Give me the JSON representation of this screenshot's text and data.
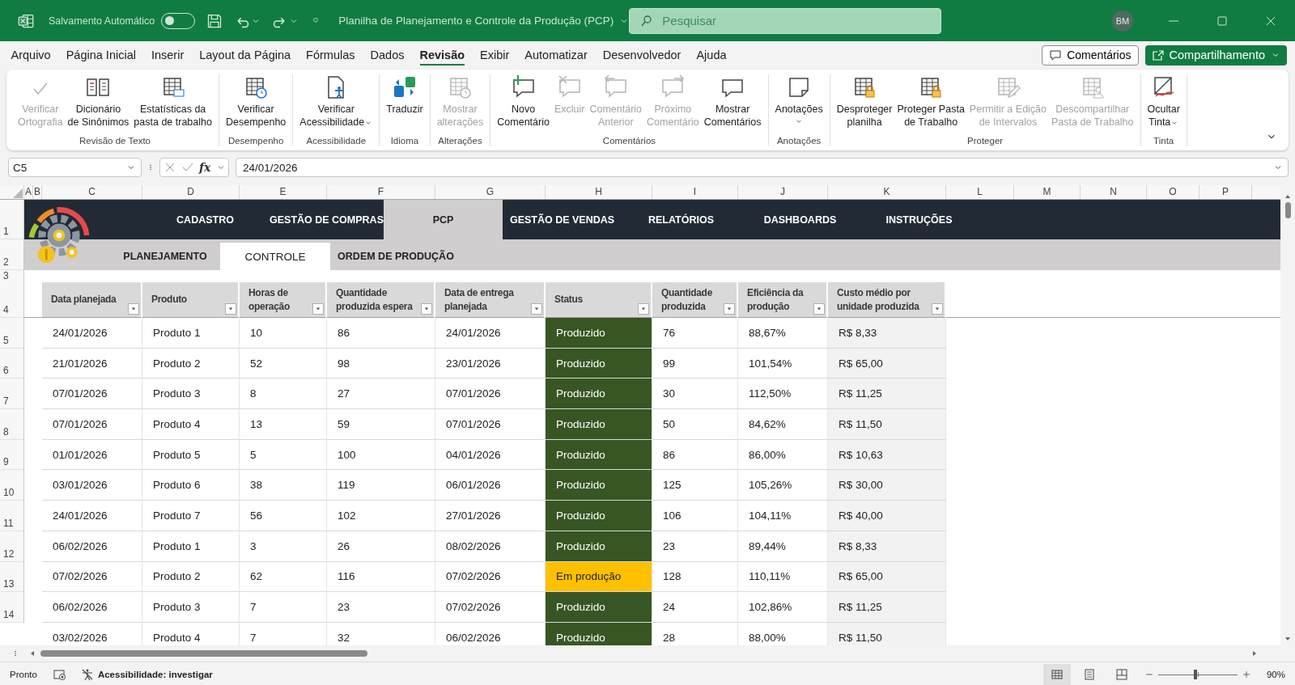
{
  "title_bar": {
    "autosave_label": "Salvamento Automático",
    "autosave_on": false,
    "title": "Planilha de Planejamento e Controle da Produção (PCP)",
    "search": {
      "placeholder": "Pesquisar"
    },
    "user_initials": "BM"
  },
  "menu_tabs": [
    {
      "label": "Arquivo",
      "selected": false
    },
    {
      "label": "Página Inicial",
      "selected": false
    },
    {
      "label": "Inserir",
      "selected": false
    },
    {
      "label": "Layout da Página",
      "selected": false
    },
    {
      "label": "Fórmulas",
      "selected": false
    },
    {
      "label": "Dados",
      "selected": false
    },
    {
      "label": "Revisão",
      "selected": true
    },
    {
      "label": "Exibir",
      "selected": false
    },
    {
      "label": "Automatizar",
      "selected": false
    },
    {
      "label": "Desenvolvedor",
      "selected": false
    },
    {
      "label": "Ajuda",
      "selected": false
    }
  ],
  "comments_button": {
    "label": "Comentários"
  },
  "share_button": {
    "label": "Compartilhamento"
  },
  "ribbon_groups": [
    {
      "label": "Revisão de Texto",
      "buttons": [
        {
          "label": "Verificar\nOrtografia",
          "disabled": true,
          "dropdown": false
        },
        {
          "label": "Dicionário\nde Sinônimos",
          "disabled": false,
          "dropdown": false
        },
        {
          "label": "Estatísticas da\npasta de trabalho",
          "disabled": false,
          "dropdown": false
        }
      ]
    },
    {
      "label": "Desempenho",
      "buttons": [
        {
          "label": "Verificar\nDesempenho",
          "disabled": false,
          "dropdown": false
        }
      ]
    },
    {
      "label": "Acessibilidade",
      "buttons": [
        {
          "label": "Verificar\nAcessibilidade",
          "disabled": false,
          "dropdown": true
        }
      ]
    },
    {
      "label": "Idioma",
      "buttons": [
        {
          "label": "Traduzir",
          "disabled": false,
          "dropdown": false
        }
      ]
    },
    {
      "label": "Alterações",
      "buttons": [
        {
          "label": "Mostrar\nalterações",
          "disabled": true,
          "dropdown": false
        }
      ]
    },
    {
      "label": "Comentários",
      "buttons": [
        {
          "label": "Novo\nComentário",
          "disabled": false,
          "dropdown": false
        },
        {
          "label": "Excluir",
          "disabled": true,
          "dropdown": false
        },
        {
          "label": "Comentário\nAnterior",
          "disabled": true,
          "dropdown": false
        },
        {
          "label": "Próximo\nComentário",
          "disabled": true,
          "dropdown": false
        },
        {
          "label": "Mostrar\nComentários",
          "disabled": false,
          "dropdown": false
        }
      ]
    },
    {
      "label": "Anotações",
      "buttons": [
        {
          "label": "Anotações",
          "disabled": false,
          "dropdown": true
        }
      ]
    },
    {
      "label": "Proteger",
      "buttons": [
        {
          "label": "Desproteger\nplanilha",
          "disabled": false,
          "dropdown": false
        },
        {
          "label": "Proteger Pasta\nde Trabalho",
          "disabled": false,
          "dropdown": false
        },
        {
          "label": "Permitir a Edição\nde Intervalos",
          "disabled": true,
          "dropdown": false
        },
        {
          "label": "Descompartilhar\nPasta de Trabalho",
          "disabled": true,
          "dropdown": false
        }
      ]
    },
    {
      "label": "Tinta",
      "buttons": [
        {
          "label": "Ocultar\nTinta",
          "disabled": false,
          "dropdown": true
        }
      ]
    }
  ],
  "formula_bar": {
    "name_box": "C5",
    "function_label": "fx",
    "formula": "24/01/2026"
  },
  "column_headers": [
    "A",
    "B",
    "C",
    "D",
    "E",
    "F",
    "G",
    "H",
    "I",
    "J",
    "K",
    "L",
    "M",
    "N",
    "O",
    "P"
  ],
  "row_numbers": [
    "1",
    "2",
    "3",
    "4",
    "5",
    "6",
    "7",
    "8",
    "9",
    "10",
    "11",
    "12",
    "13",
    "14"
  ],
  "sheet": {
    "nav_tabs": [
      {
        "label": "CADASTRO",
        "selected": false
      },
      {
        "label": "GESTÃO DE COMPRAS",
        "selected": false
      },
      {
        "label": "PCP",
        "selected": true
      },
      {
        "label": "GESTÃO DE VENDAS",
        "selected": false
      },
      {
        "label": "RELATÓRIOS",
        "selected": false
      },
      {
        "label": "DASHBOARDS",
        "selected": false
      },
      {
        "label": "INSTRUÇÕES",
        "selected": false
      }
    ],
    "sub_tabs": [
      {
        "label": "PLANEJAMENTO",
        "selected": false
      },
      {
        "label": "CONTROLE",
        "selected": true
      },
      {
        "label": "ORDEM DE PRODUÇÃO",
        "selected": false
      }
    ],
    "table": {
      "columns": [
        {
          "label": "Data planejada",
          "kind": "text"
        },
        {
          "label": "Produto",
          "kind": "text"
        },
        {
          "label": "Horas de\noperação",
          "kind": "text"
        },
        {
          "label": "Quantidade\nproduzida espera",
          "kind": "text"
        },
        {
          "label": "Data de entrega\nplanejada",
          "kind": "text"
        },
        {
          "label": "Status",
          "kind": "status"
        },
        {
          "label": "Quantidade\nproduzida",
          "kind": "text"
        },
        {
          "label": "Eficiência da\nprodução",
          "kind": "text"
        },
        {
          "label": "Custo médio por\nunidade produzida",
          "kind": "shaded"
        }
      ],
      "rows": [
        {
          "cells": [
            "24/01/2026",
            "Produto 1",
            "10",
            "86",
            "24/01/2026",
            "Produzido",
            "76",
            "88,67%",
            "R$ 8,33"
          ],
          "color": "#375623"
        },
        {
          "cells": [
            "21/01/2026",
            "Produto 2",
            "52",
            "98",
            "23/01/2026",
            "Produzido",
            "99",
            "101,54%",
            "R$ 65,00"
          ],
          "color": "#375623"
        },
        {
          "cells": [
            "07/01/2026",
            "Produto 3",
            "8",
            "27",
            "07/01/2026",
            "Produzido",
            "30",
            "112,50%",
            "R$ 11,25"
          ],
          "color": "#375623"
        },
        {
          "cells": [
            "07/01/2026",
            "Produto 4",
            "13",
            "59",
            "07/01/2026",
            "Produzido",
            "50",
            "84,62%",
            "R$ 11,50"
          ],
          "color": "#375623"
        },
        {
          "cells": [
            "01/01/2026",
            "Produto 5",
            "5",
            "100",
            "04/01/2026",
            "Produzido",
            "86",
            "86,00%",
            "R$ 10,63"
          ],
          "color": "#375623"
        },
        {
          "cells": [
            "03/01/2026",
            "Produto 6",
            "38",
            "119",
            "06/01/2026",
            "Produzido",
            "125",
            "105,26%",
            "R$ 30,00"
          ],
          "color": "#375623"
        },
        {
          "cells": [
            "24/01/2026",
            "Produto 7",
            "56",
            "102",
            "27/01/2026",
            "Produzido",
            "106",
            "104,11%",
            "R$ 40,00"
          ],
          "color": "#375623"
        },
        {
          "cells": [
            "06/02/2026",
            "Produto 1",
            "3",
            "26",
            "08/02/2026",
            "Produzido",
            "23",
            "89,44%",
            "R$ 8,33"
          ],
          "color": "#375623"
        },
        {
          "cells": [
            "07/02/2026",
            "Produto 2",
            "62",
            "116",
            "07/02/2026",
            "Em produção",
            "128",
            "110,11%",
            "R$ 65,00"
          ],
          "color": "#ffc000"
        },
        {
          "cells": [
            "06/02/2026",
            "Produto 3",
            "7",
            "23",
            "07/02/2026",
            "Produzido",
            "24",
            "102,86%",
            "R$ 11,25"
          ],
          "color": "#375623"
        },
        {
          "cells": [
            "03/02/2026",
            "Produto 4",
            "7",
            "32",
            "06/02/2026",
            "Produzido",
            "28",
            "88,00%",
            "R$ 11,50"
          ],
          "color": "#375623"
        }
      ]
    }
  },
  "status_bar": {
    "ready": "Pronto",
    "accessibility": "Acessibilidade: investigar",
    "view_buttons": [
      {
        "selected": true
      },
      {
        "selected": false
      },
      {
        "selected": false
      }
    ],
    "zoom_slider": {
      "level": 0.47
    },
    "zoom": "90%"
  }
}
